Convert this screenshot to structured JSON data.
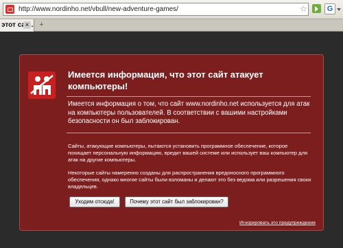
{
  "browser": {
    "url": "http://www.nordinho.net/vbull/new-adventure-games/",
    "star_icon": "star-icon",
    "go_icon": "go-arrow-icon",
    "search_engine_icon": "google-icon",
    "search_engine_letter": "G",
    "tabs": [
      {
        "label": "этот сай...",
        "active": true
      }
    ],
    "tab_close_glyph": "×",
    "new_tab_glyph": "+"
  },
  "warning": {
    "icon": "blocked-attack-site-icon",
    "title": "Имеется информация, что этот сайт атакует компьютеры!",
    "lead": "Имеется информация о том, что сайт www.nordinho.net используется для атак на компьютеры пользователей. В соответствии с вашими настройками безопасности он был заблокирован.",
    "paragraph_1": "Сайты, атакующие компьютеры, пытаются установить программное обеспечение, которое похищает персональную информацию, вредит вашей системе или использует ваш компьютер для атак на другие компьютеры.",
    "paragraph_2": "Некоторые сайты намеренно созданы для распространения вредоносного программного обеспечения, однако многие сайты были взломаны и делают это без ведома или разрешения своих владельцев.",
    "get_out_button": "Уходим отсюда!",
    "why_blocked_button": "Почему этот сайт был заблокирован?",
    "ignore_link": "Игнорировать это предупреждение"
  },
  "colors": {
    "page_background": "#2b2b2b",
    "panel_background": "#7c1e1e",
    "icon_background": "#c81f1f"
  }
}
